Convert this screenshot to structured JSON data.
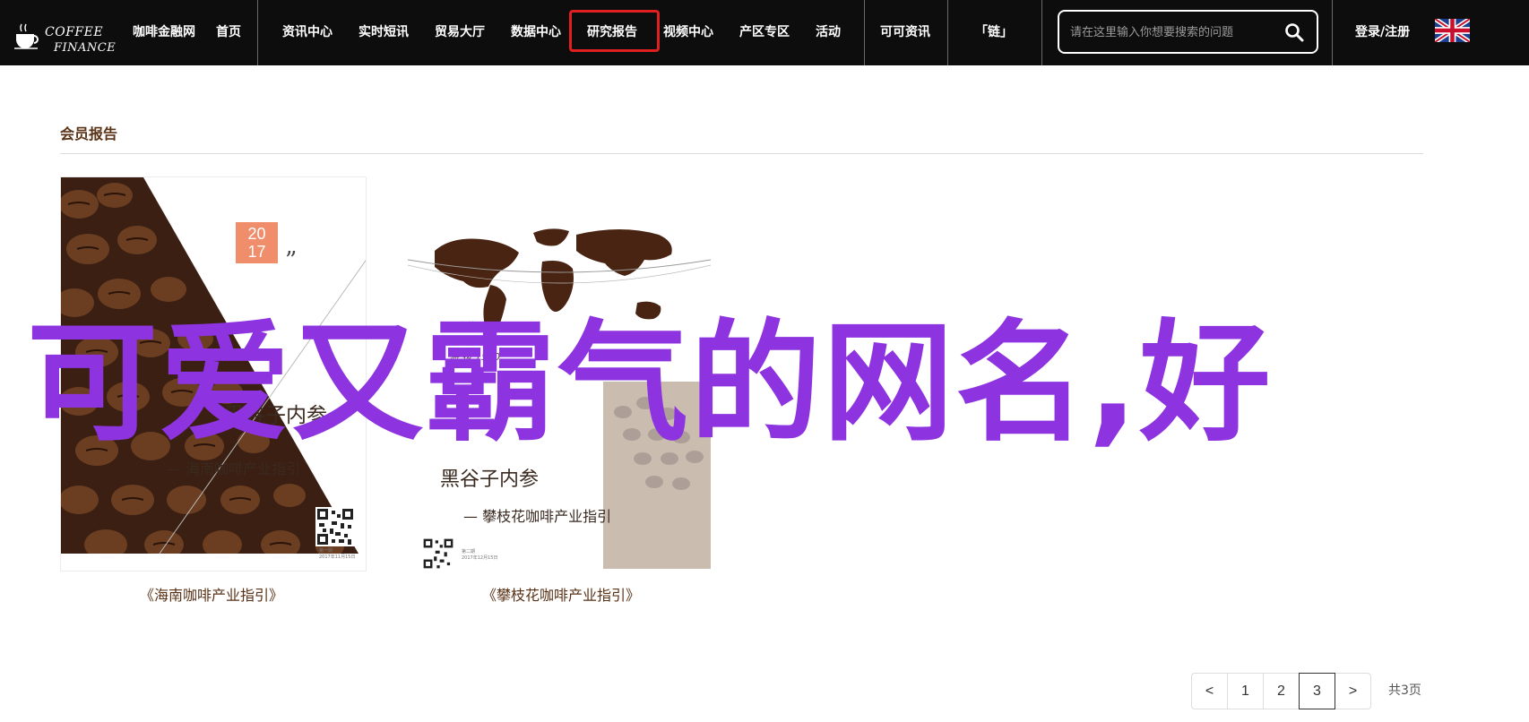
{
  "header": {
    "logo": {
      "line1": "COFFEE",
      "line2": "FINANCE"
    },
    "nav": [
      {
        "label": "咖啡金融网",
        "name": "nav-item-coffee-finance"
      },
      {
        "label": "首页",
        "name": "nav-item-home"
      },
      {
        "label": "资讯中心",
        "name": "nav-item-news"
      },
      {
        "label": "实时短讯",
        "name": "nav-item-flash"
      },
      {
        "label": "贸易大厅",
        "name": "nav-item-trade"
      },
      {
        "label": "数据中心",
        "name": "nav-item-data"
      },
      {
        "label": "研究报告",
        "name": "nav-item-research"
      },
      {
        "label": "视频中心",
        "name": "nav-item-video"
      },
      {
        "label": "产区专区",
        "name": "nav-item-region"
      },
      {
        "label": "活动",
        "name": "nav-item-events"
      },
      {
        "label": "可可资讯",
        "name": "nav-item-cocoa"
      },
      {
        "label": "「链」",
        "name": "nav-item-chain"
      }
    ],
    "search": {
      "placeholder": "请在这里输入你想要搜索的问题",
      "icon": "search-icon"
    },
    "login_label": "登录/注册",
    "language_icon": "uk-flag-icon",
    "highlight_color": "#e02020"
  },
  "section": {
    "title": "会员报告"
  },
  "reports": [
    {
      "caption": "《海南咖啡产业指引》",
      "poster": {
        "year_top": "20",
        "year_bottom": "17",
        "quote_mark": "”",
        "title": "黑谷子内参",
        "subtitle": "— 海南咖啡产业指引",
        "qr_caption_1": "第一期",
        "qr_caption_2": "2017年11月15日"
      }
    },
    {
      "caption": "《攀枝花咖啡产业指引》",
      "poster": {
        "coord_1": "· 海拔 1500",
        "coord_2": "北 纬 26°",
        "coord_3": "海 拔 1500",
        "title": "黑谷子内参",
        "subtitle": "— 攀枝花咖啡产业指引",
        "qr_caption_1": "第二期",
        "qr_caption_2": "2017年12月15日"
      }
    }
  ],
  "overlay_text": "可爱又霸气的网名,好",
  "pagination": {
    "prev": "<",
    "pages": [
      "1",
      "2",
      "3"
    ],
    "current": "3",
    "next": ">",
    "total": "共3页"
  },
  "colors": {
    "topbar": "#0d0d0d",
    "accent_brown": "#5a3216",
    "overlay_purple": "#8d33e0",
    "year_box": "#f08d6a"
  }
}
